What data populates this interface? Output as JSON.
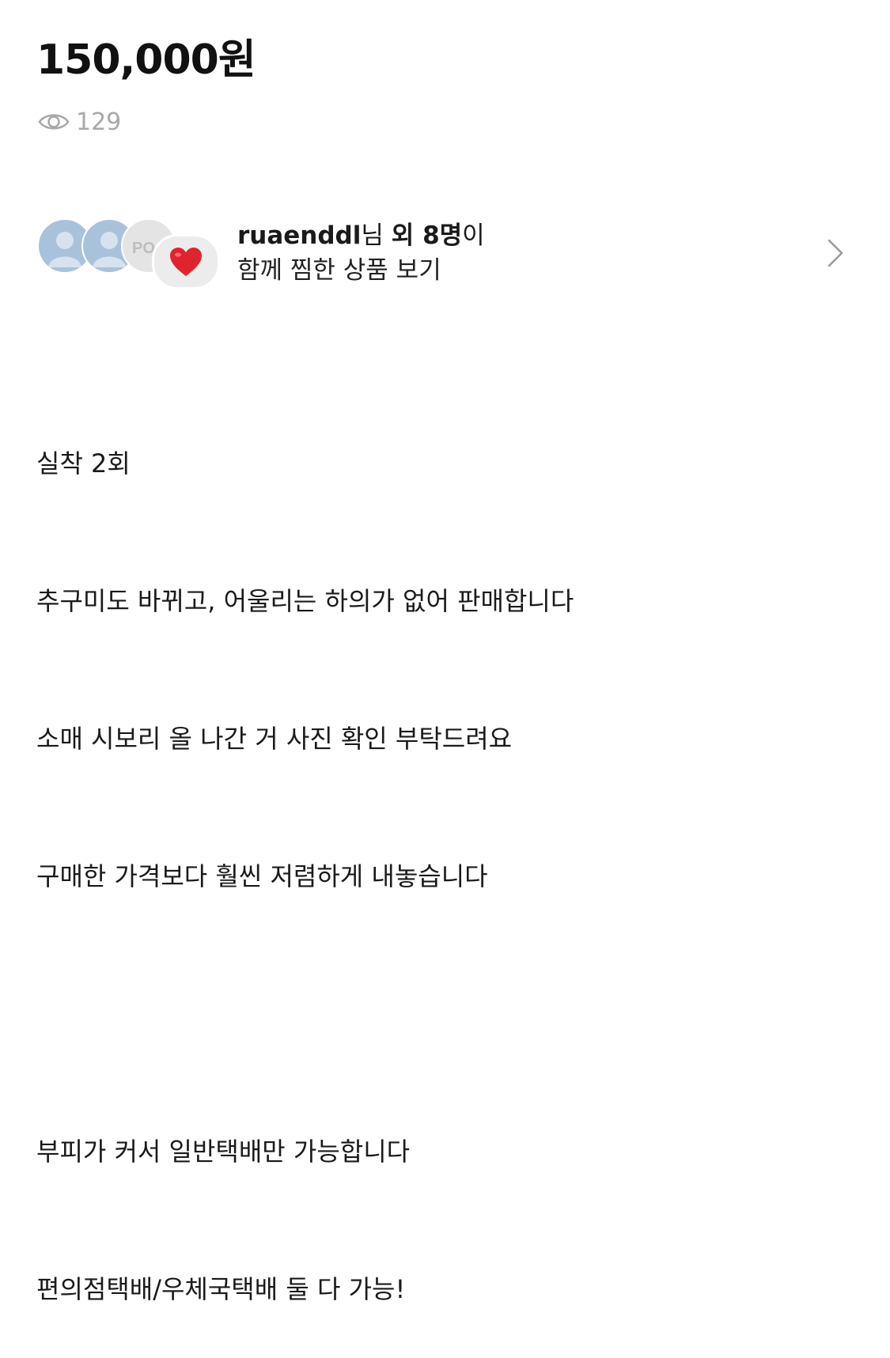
{
  "price": "150,000원",
  "views": {
    "icon": "eye-icon",
    "count": "129"
  },
  "likers": {
    "avatars": [
      "avatar-default",
      "avatar-default",
      "avatar-po"
    ],
    "avatar3_text": "PO",
    "heart_icon": "heart-icon",
    "heart_color": "#e0242e",
    "username": "ruaenddl",
    "suffix1": "님 ",
    "others": "외 8명",
    "suffix2": "이",
    "line2": "함께 찜한 상품 보기",
    "chevron_icon": "chevron-right-icon"
  },
  "description": [
    "실착 2회",
    "추구미도 바뀌고, 어울리는 하의가 없어 판매합니다",
    "소매 시보리 올 나간 거 사진 확인 부탁드려요",
    "구매한 가격보다 훨씬 저렴하게 내놓습니다",
    "",
    "부피가 커서 일반택배만 가능합니다",
    "편의점택배/우체국택배 둘 다 가능!"
  ]
}
